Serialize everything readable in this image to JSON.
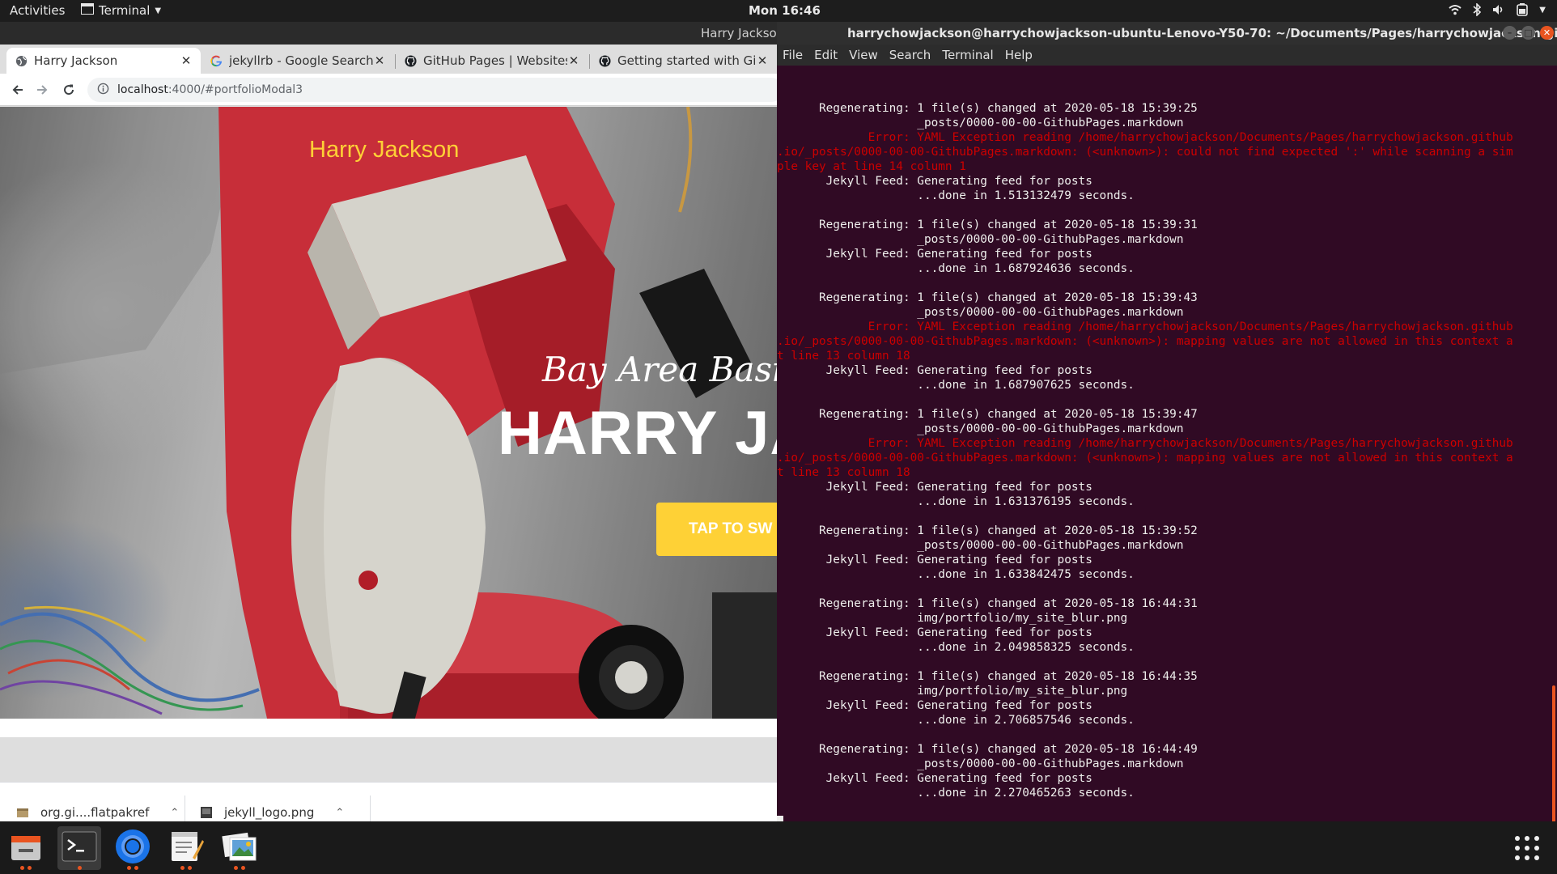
{
  "topbar": {
    "activities": "Activities",
    "app_menu": "Terminal",
    "clock": "Mon 16:46"
  },
  "browser": {
    "window_title": "Harry Jackson",
    "tabs": [
      {
        "title": "Harry Jackson",
        "icon": "globe-icon"
      },
      {
        "title": "jekyllrb - Google Search",
        "icon": "google-icon"
      },
      {
        "title": "GitHub Pages | Websites f",
        "icon": "github-icon"
      },
      {
        "title": "Getting started with GitH",
        "icon": "github-icon"
      }
    ],
    "url_host": "localhost",
    "url_rest": ":4000/#portfolioModal3",
    "page": {
      "brand": "Harry Jackson",
      "subheading": "Bay Area Basic",
      "heading": "HARRY JA",
      "cta": "TAP TO SW"
    },
    "downloads": [
      {
        "name": "org.gi....flatpakref"
      },
      {
        "name": "jekyll_logo.png"
      }
    ]
  },
  "terminal": {
    "title": "harrychowjackson@harrychowjackson-ubuntu-Lenovo-Y50-70: ~/Documents/Pages/harrychowjackson.github.io",
    "menu": [
      "File",
      "Edit",
      "View",
      "Search",
      "Terminal",
      "Help"
    ],
    "lines": [
      {
        "text": "      Regenerating: 1 file(s) changed at 2020-05-18 15:39:25",
        "type": "normal"
      },
      {
        "text": "                    _posts/0000-00-00-GithubPages.markdown",
        "type": "normal"
      },
      {
        "text": "             Error: YAML Exception reading /home/harrychowjackson/Documents/Pages/harrychowjackson.github",
        "type": "err"
      },
      {
        "text": ".io/_posts/0000-00-00-GithubPages.markdown: (<unknown>): could not find expected ':' while scanning a sim",
        "type": "err"
      },
      {
        "text": "ple key at line 14 column 1",
        "type": "err"
      },
      {
        "text": "       Jekyll Feed: Generating feed for posts",
        "type": "normal"
      },
      {
        "text": "                    ...done in 1.513132479 seconds.",
        "type": "normal"
      },
      {
        "text": "",
        "type": "normal"
      },
      {
        "text": "      Regenerating: 1 file(s) changed at 2020-05-18 15:39:31",
        "type": "normal"
      },
      {
        "text": "                    _posts/0000-00-00-GithubPages.markdown",
        "type": "normal"
      },
      {
        "text": "       Jekyll Feed: Generating feed for posts",
        "type": "normal"
      },
      {
        "text": "                    ...done in 1.687924636 seconds.",
        "type": "normal"
      },
      {
        "text": "",
        "type": "normal"
      },
      {
        "text": "      Regenerating: 1 file(s) changed at 2020-05-18 15:39:43",
        "type": "normal"
      },
      {
        "text": "                    _posts/0000-00-00-GithubPages.markdown",
        "type": "normal"
      },
      {
        "text": "             Error: YAML Exception reading /home/harrychowjackson/Documents/Pages/harrychowjackson.github",
        "type": "err"
      },
      {
        "text": ".io/_posts/0000-00-00-GithubPages.markdown: (<unknown>): mapping values are not allowed in this context a",
        "type": "err"
      },
      {
        "text": "t line 13 column 18",
        "type": "err"
      },
      {
        "text": "       Jekyll Feed: Generating feed for posts",
        "type": "normal"
      },
      {
        "text": "                    ...done in 1.687907625 seconds.",
        "type": "normal"
      },
      {
        "text": "",
        "type": "normal"
      },
      {
        "text": "      Regenerating: 1 file(s) changed at 2020-05-18 15:39:47",
        "type": "normal"
      },
      {
        "text": "                    _posts/0000-00-00-GithubPages.markdown",
        "type": "normal"
      },
      {
        "text": "             Error: YAML Exception reading /home/harrychowjackson/Documents/Pages/harrychowjackson.github",
        "type": "err"
      },
      {
        "text": ".io/_posts/0000-00-00-GithubPages.markdown: (<unknown>): mapping values are not allowed in this context a",
        "type": "err"
      },
      {
        "text": "t line 13 column 18",
        "type": "err"
      },
      {
        "text": "       Jekyll Feed: Generating feed for posts",
        "type": "normal"
      },
      {
        "text": "                    ...done in 1.631376195 seconds.",
        "type": "normal"
      },
      {
        "text": "",
        "type": "normal"
      },
      {
        "text": "      Regenerating: 1 file(s) changed at 2020-05-18 15:39:52",
        "type": "normal"
      },
      {
        "text": "                    _posts/0000-00-00-GithubPages.markdown",
        "type": "normal"
      },
      {
        "text": "       Jekyll Feed: Generating feed for posts",
        "type": "normal"
      },
      {
        "text": "                    ...done in 1.633842475 seconds.",
        "type": "normal"
      },
      {
        "text": "",
        "type": "normal"
      },
      {
        "text": "      Regenerating: 1 file(s) changed at 2020-05-18 16:44:31",
        "type": "normal"
      },
      {
        "text": "                    img/portfolio/my_site_blur.png",
        "type": "normal"
      },
      {
        "text": "       Jekyll Feed: Generating feed for posts",
        "type": "normal"
      },
      {
        "text": "                    ...done in 2.049858325 seconds.",
        "type": "normal"
      },
      {
        "text": "",
        "type": "normal"
      },
      {
        "text": "      Regenerating: 1 file(s) changed at 2020-05-18 16:44:35",
        "type": "normal"
      },
      {
        "text": "                    img/portfolio/my_site_blur.png",
        "type": "normal"
      },
      {
        "text": "       Jekyll Feed: Generating feed for posts",
        "type": "normal"
      },
      {
        "text": "                    ...done in 2.706857546 seconds.",
        "type": "normal"
      },
      {
        "text": "",
        "type": "normal"
      },
      {
        "text": "      Regenerating: 1 file(s) changed at 2020-05-18 16:44:49",
        "type": "normal"
      },
      {
        "text": "                    _posts/0000-00-00-GithubPages.markdown",
        "type": "normal"
      },
      {
        "text": "       Jekyll Feed: Generating feed for posts",
        "type": "normal"
      },
      {
        "text": "                    ...done in 2.270465263 seconds.",
        "type": "normal"
      },
      {
        "text": "",
        "type": "normal"
      }
    ]
  },
  "dock": {
    "items": [
      {
        "icon": "file-manager-icon",
        "dots": 2
      },
      {
        "icon": "terminal-icon",
        "dots": 1
      },
      {
        "icon": "chrome-icon",
        "dots": 2
      },
      {
        "icon": "text-editor-icon",
        "dots": 2
      },
      {
        "icon": "image-viewer-icon",
        "dots": 2
      }
    ],
    "apps": "show-applications-icon"
  },
  "colors": {
    "accent": "#fed136",
    "terminal_bg": "#300a24",
    "error": "#cc0000",
    "ubuntu_orange": "#e95420"
  }
}
